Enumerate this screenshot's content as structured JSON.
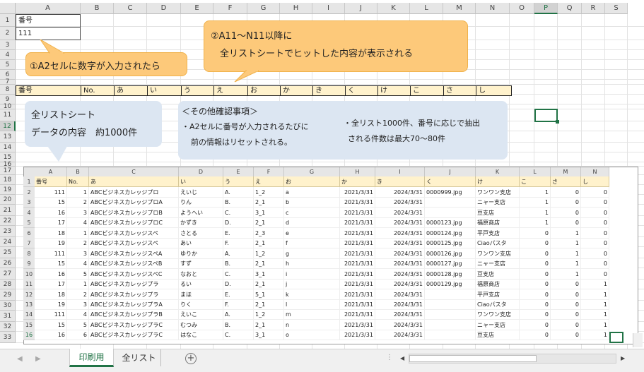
{
  "outer": {
    "columns": [
      "A",
      "B",
      "C",
      "D",
      "E",
      "F",
      "G",
      "H",
      "I",
      "J",
      "K",
      "L",
      "M",
      "N",
      "O",
      "P",
      "Q",
      "R",
      "S"
    ],
    "rows": [
      "1",
      "2",
      "3",
      "4",
      "5",
      "6",
      "7",
      "8",
      "9",
      "10",
      "11",
      "12",
      "13",
      "14",
      "15",
      "16",
      "17",
      "18",
      "19",
      "20",
      "21",
      "22",
      "23",
      "24",
      "25",
      "26",
      "27",
      "28",
      "29",
      "30",
      "31",
      "32",
      "33"
    ],
    "a1": "番号",
    "a2": "111",
    "row10_headers": [
      "番号",
      "No.",
      "あ",
      "い",
      "う",
      "え",
      "お",
      "か",
      "き",
      "く",
      "け",
      "こ",
      "さ",
      "し"
    ]
  },
  "callouts": {
    "step1": "①A2セルに数字が入力されたら",
    "step2_line1": "②A11～N11以降に",
    "step2_line2": "全リストシートでヒットした内容が表示される",
    "list_line1": "全リストシート",
    "list_line2": "データの内容　約1000件",
    "notes_title": "＜その他確認事項＞",
    "notes_a_line1": "・A2セルに番号が入力されるたびに",
    "notes_a_line2": "前の情報はリセットされる。",
    "notes_b_line1": "・全リスト1000件、番号に応じで抽出",
    "notes_b_line2": "される件数は最大70～80件"
  },
  "inner": {
    "columns": [
      "A",
      "B",
      "C",
      "D",
      "E",
      "F",
      "G",
      "H",
      "I",
      "J",
      "K",
      "L",
      "M",
      "N"
    ],
    "header_row": "1",
    "headers": [
      "番号",
      "No.",
      "あ",
      "い",
      "う",
      "え",
      "お",
      "か",
      "き",
      "く",
      "け",
      "こ",
      "さ",
      "し"
    ],
    "rows": [
      {
        "rn": "2",
        "cells": [
          "111",
          "1",
          "ABCビジネスカレッジプロ",
          "えいじ",
          "A.",
          "1_2",
          "a",
          "2021/3/31",
          "2024/3/31",
          "0000999.jpg",
          "ワンワン支店",
          "1",
          "0",
          "0"
        ]
      },
      {
        "rn": "3",
        "cells": [
          "15",
          "2",
          "ABCビジネスカレッジプロA",
          "りん",
          "B.",
          "2_1",
          "b",
          "2021/3/31",
          "2024/3/31",
          "",
          "ニャー支店",
          "1",
          "0",
          "0"
        ]
      },
      {
        "rn": "4",
        "cells": [
          "16",
          "3",
          "ABCビジネスカレッジプロB",
          "ようへい",
          "C.",
          "3_1",
          "c",
          "2021/3/31",
          "2024/3/31",
          "",
          "豆支店",
          "1",
          "0",
          "0"
        ]
      },
      {
        "rn": "5",
        "cells": [
          "17",
          "4",
          "ABCビジネスカレッジプロC",
          "かずき",
          "D.",
          "2_1",
          "d",
          "2021/3/31",
          "2024/3/31",
          "0000123.jpg",
          "福原商店",
          "1",
          "0",
          "0"
        ]
      },
      {
        "rn": "6",
        "cells": [
          "18",
          "1",
          "ABCビジネスカレッジスペ",
          "さとる",
          "E.",
          "2_3",
          "e",
          "2021/3/31",
          "2024/3/31",
          "0000124.jpg",
          "平戸支店",
          "0",
          "1",
          "0"
        ]
      },
      {
        "rn": "7",
        "cells": [
          "19",
          "2",
          "ABCビジネスカレッジスペ",
          "あい",
          "F.",
          "2_1",
          "f",
          "2021/3/31",
          "2024/3/31",
          "0000125.jpg",
          "Ciaoパスタ",
          "0",
          "1",
          "0"
        ]
      },
      {
        "rn": "8",
        "cells": [
          "111",
          "3",
          "ABCビジネスカレッジスペA",
          "ゆりか",
          "A.",
          "1_2",
          "g",
          "2021/3/31",
          "2024/3/31",
          "0000126.jpg",
          "ワンワン支店",
          "0",
          "1",
          "0"
        ]
      },
      {
        "rn": "9",
        "cells": [
          "15",
          "4",
          "ABCビジネスカレッジスペB",
          "すず",
          "B.",
          "2_1",
          "h",
          "2021/3/31",
          "2024/3/31",
          "0000127.jpg",
          "ニャー支店",
          "0",
          "1",
          "0"
        ]
      },
      {
        "rn": "10",
        "cells": [
          "16",
          "5",
          "ABCビジネスカレッジスペC",
          "なおと",
          "C.",
          "3_1",
          "i",
          "2021/3/31",
          "2024/3/31",
          "0000128.jpg",
          "豆支店",
          "0",
          "1",
          "0"
        ]
      },
      {
        "rn": "11",
        "cells": [
          "17",
          "1",
          "ABCビジネスカレッジプラ",
          "るい",
          "D.",
          "2_1",
          "j",
          "2021/3/31",
          "2024/3/31",
          "0000129.jpg",
          "福原商店",
          "0",
          "0",
          "1"
        ]
      },
      {
        "rn": "12",
        "cells": [
          "18",
          "2",
          "ABCビジネスカレッジプラ",
          "まほ",
          "E.",
          "5_1",
          "k",
          "2021/3/31",
          "2024/3/31",
          "",
          "平戸支店",
          "0",
          "0",
          "1"
        ]
      },
      {
        "rn": "13",
        "cells": [
          "19",
          "3",
          "ABCビジネスカレッジプラA",
          "りく",
          "F.",
          "2_1",
          "l",
          "2021/3/31",
          "2024/3/31",
          "",
          "Ciaoパスタ",
          "0",
          "0",
          "1"
        ]
      },
      {
        "rn": "14",
        "cells": [
          "111",
          "4",
          "ABCビジネスカレッジプラB",
          "えいこ",
          "A.",
          "1_2",
          "m",
          "2021/3/31",
          "2024/3/31",
          "",
          "ワンワン支店",
          "0",
          "0",
          "1"
        ]
      },
      {
        "rn": "15",
        "cells": [
          "15",
          "5",
          "ABCビジネスカレッジプラC",
          "むつみ",
          "B.",
          "2_1",
          "n",
          "2021/3/31",
          "2024/3/31",
          "",
          "ニャー支店",
          "0",
          "0",
          "1"
        ]
      },
      {
        "rn": "16",
        "cells": [
          "16",
          "6",
          "ABCビジネスカレッジプラC",
          "はなこ",
          "C.",
          "3_1",
          "o",
          "2021/3/31",
          "2024/3/31",
          "",
          "豆支店",
          "0",
          "0",
          "1"
        ]
      }
    ]
  },
  "tabs": [
    "印刷用",
    "全リスト"
  ],
  "active_tab": "印刷用",
  "colors": {
    "accent": "#217346",
    "orange": "#fdc97a",
    "blue": "#dce6f2",
    "header_fill": "#fff2cc"
  }
}
